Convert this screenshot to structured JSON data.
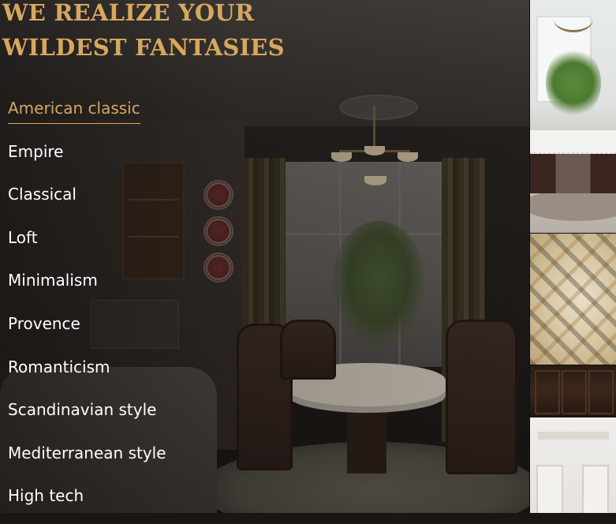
{
  "hero": {
    "headline_line1": "WE REALIZE YOUR",
    "headline_line2": "WILDEST FANTASIES"
  },
  "styles_menu": {
    "items": [
      {
        "label": "American classic",
        "active": true
      },
      {
        "label": "Empire",
        "active": false
      },
      {
        "label": "Classical",
        "active": false
      },
      {
        "label": "Loft",
        "active": false
      },
      {
        "label": "Minimalism",
        "active": false
      },
      {
        "label": "Provence",
        "active": false
      },
      {
        "label": "Romanticism",
        "active": false
      },
      {
        "label": "Scandinavian style",
        "active": false
      },
      {
        "label": "Mediterranean style",
        "active": false
      },
      {
        "label": "High tech",
        "active": false
      }
    ]
  },
  "colors": {
    "accent": "#d7a75f",
    "menu_text": "#ffffff",
    "overlay": "#1a1614"
  }
}
